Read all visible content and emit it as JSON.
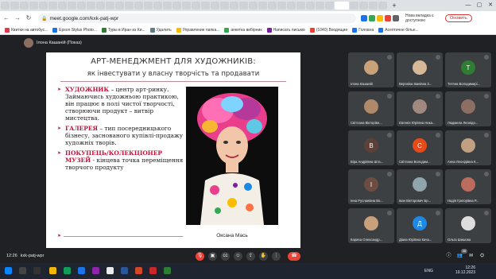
{
  "browser": {
    "url": "meet.google.com/kxk-patj-wpr",
    "profile_note": "Нова вкладка є доступною",
    "update_label": "Оновить"
  },
  "bookmarks": [
    {
      "label": "Квитки на автобус...",
      "color": "#e2384d"
    },
    {
      "label": "Epson Stylus Photo...",
      "color": "#1a73e8"
    },
    {
      "label": "Туры в Иран из Ки...",
      "color": "#2e7d32"
    },
    {
      "label": "Удалить",
      "color": "#607d8b"
    },
    {
      "label": "Управление папка...",
      "color": "#fbbc04"
    },
    {
      "label": "анкетка вибірник",
      "color": "#34a853"
    },
    {
      "label": "Написать письмо",
      "color": "#7b1fa2"
    },
    {
      "label": "(1040) Входящие",
      "color": "#ea4335"
    },
    {
      "label": "Головна",
      "color": "#1a73e8"
    },
    {
      "label": "Асептичне білье...",
      "color": "#1a73e8"
    }
  ],
  "meeting": {
    "presenter": "Ілона Кашаній (Показ)",
    "time": "12:26",
    "code": "kxk-patj-wpr"
  },
  "slide": {
    "title": "АРТ-МЕНЕДЖМЕНТ ДЛЯ ХУДОЖНИКІВ:",
    "subtitle": "як інвестувати у власну творчість та продавати",
    "bullets": [
      {
        "head": "ХУДОЖНИК",
        "text": " – центр арт-ринку. Займаючись художньою практикою, він працює в полі чистої творчості, створюючи продукт – витвір мистецтва."
      },
      {
        "head": "ГАЛЕРЕЯ",
        "text": " – тип посередницького бізнесу, заснованого купівлі-продажу художніх творів."
      },
      {
        "head": "ПОКУПЕЦЬ/КОЛЕКЦІОНЕР МУЗЕЙ",
        "text": " - кінцева точка переміщення творчого продукту"
      }
    ],
    "caption": "Оксана Мась"
  },
  "participants": [
    {
      "name": "Ілона Кашаній",
      "initial": "",
      "color": "#c9a27a"
    },
    {
      "name": "Вероніка Іванівна З...",
      "initial": "",
      "color": "#d7b899"
    },
    {
      "name": "Тетяна Володимирі...",
      "initial": "Т",
      "color": "#2e7d32"
    },
    {
      "name": "Світлана Вікторівн...",
      "initial": "",
      "color": "#b08968"
    },
    {
      "name": "Євгенія Юріївна Ника...",
      "initial": "",
      "color": "#a1887f"
    },
    {
      "name": "Людмила Леонідо...",
      "initial": "",
      "color": "#8d6e63"
    },
    {
      "name": "Віра Андріївна Шта...",
      "initial": "В",
      "color": "#5d4037"
    },
    {
      "name": "Світлана Володим...",
      "initial": "С",
      "color": "#e64a19"
    },
    {
      "name": "Анна Леонідівна К...",
      "initial": "",
      "color": "#c0a080"
    },
    {
      "name": "Інна Русланівна Во...",
      "initial": "І",
      "color": "#6d4c41"
    },
    {
      "name": "Іван Вікторович Бр...",
      "initial": "",
      "color": "#90a4ae"
    },
    {
      "name": "Надія Григорівна Р...",
      "initial": "",
      "color": "#bc6c5c"
    },
    {
      "name": "Карина Олександр...",
      "initial": "",
      "color": "#c8a07c"
    },
    {
      "name": "Діана Юріївна Кача...",
      "initial": "Д",
      "color": "#1e88e5"
    },
    {
      "name": "Ольга Шишова",
      "initial": "",
      "color": "#ddd"
    }
  ],
  "taskbar": {
    "language": "ENG",
    "time": "12:26",
    "date": "19.12.2023"
  },
  "colors": {
    "accent_red": "#c0143a",
    "meet_bg": "#202124",
    "end_call": "#ea4335"
  }
}
